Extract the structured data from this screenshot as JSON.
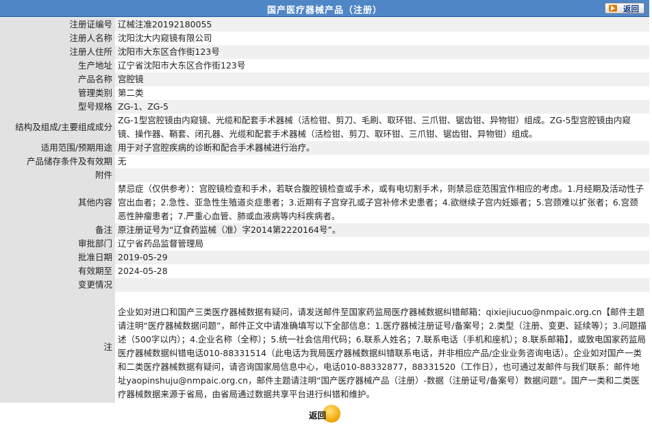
{
  "header": {
    "title": "国产医疗器械产品（注册）",
    "back_label": "返回"
  },
  "rows": [
    {
      "label": "注册证编号",
      "value": "辽械注准20192180055"
    },
    {
      "label": "注册人名称",
      "value": "沈阳沈大内窥镜有限公司"
    },
    {
      "label": "注册人住所",
      "value": "沈阳市大东区合作街123号"
    },
    {
      "label": "生产地址",
      "value": "辽宁省沈阳市大东区合作街123号"
    },
    {
      "label": "产品名称",
      "value": "宫腔镜"
    },
    {
      "label": "管理类别",
      "value": "第二类"
    },
    {
      "label": "型号规格",
      "value": "ZG-1、ZG-5"
    },
    {
      "label": "结构及组成/主要组成成分",
      "value": "ZG-1型宫腔镜由内窥镜、光缆和配套手术器械（活检钳、剪刀、毛刷、取环钳、三爪钳、锯齿钳、异物钳）组成。ZG-5型宫腔镜由内窥镜、操作器、鞘套、闭孔器、光缆和配套手术器械（活检钳、剪刀、取环钳、三爪钳、锯齿钳、异物钳）组成。"
    },
    {
      "label": "适用范围/预期用途",
      "value": "用于对子宫腔疾病的诊断和配合手术器械进行治疗。"
    },
    {
      "label": "产品储存条件及有效期",
      "value": "无"
    },
    {
      "label": "附件",
      "value": ""
    },
    {
      "label": "其他内容",
      "value": "禁忌症（仅供参考）：宫腔镜检查和手术，若联合腹腔镜检查或手术，或有电切割手术，则禁忌症范围宜作相应的考虑。1.月经期及活动性子宫出血者；2.急性、亚急性生殖道炎症患者；3.近期有子宫穿孔或子宫补修术史患者；4.欲继续子宫内妊娠者；5.宫颈难以扩张者；6.宫颈恶性肿瘤患者；7.严重心血管、肺或血液病等内科疾病者。"
    },
    {
      "label": "备注",
      "value": "原注册证号为“辽食药监械（准）字2014第2220164号”。"
    },
    {
      "label": "审批部门",
      "value": "辽宁省药品监督管理局"
    },
    {
      "label": "批准日期",
      "value": "2019-05-29"
    },
    {
      "label": "有效期至",
      "value": "2024-05-28"
    },
    {
      "label": "变更情况",
      "value": ""
    },
    {
      "label": "注",
      "value": "企业如对进口和国产三类医疗器械数据有疑问，请发送邮件至国家药监局医疗器械数据纠错邮箱：qixiejiucuo@nmpaic.org.cn【邮件主题请注明“医疗器械数据问题”，邮件正文中请准确填写以下全部信息：1.医疗器械注册证号/备案号；2.类型（注册、变更、延续等）；3.问题描述（500字以内）；4.企业名称（全称）；5.统一社会信用代码；6.联系人姓名；7.联系电话（手机和座机）；8.联系邮箱】，或致电国家药监局医疗器械数据纠错电话010-88331514（此电话为我局医疗器械数据纠错联系电话，并非相应产品/企业业务咨询电话）。企业如对国产一类和二类医疗器械数据有疑问，请咨询国家局信息中心，电话010-88332877，88331520（工作日），也可通过发邮件与我们联系：邮件地址yaopinshuju@nmpaic.org.cn，邮件主题请注明“国产医疗器械产品（注册）-数据（注册证号/备案号）数据问题”。国产一类和二类医疗器械数据来源于省局，由省局通过数据共享平台进行纠错和维护。"
    }
  ],
  "footer": {
    "back_label": "返回"
  }
}
